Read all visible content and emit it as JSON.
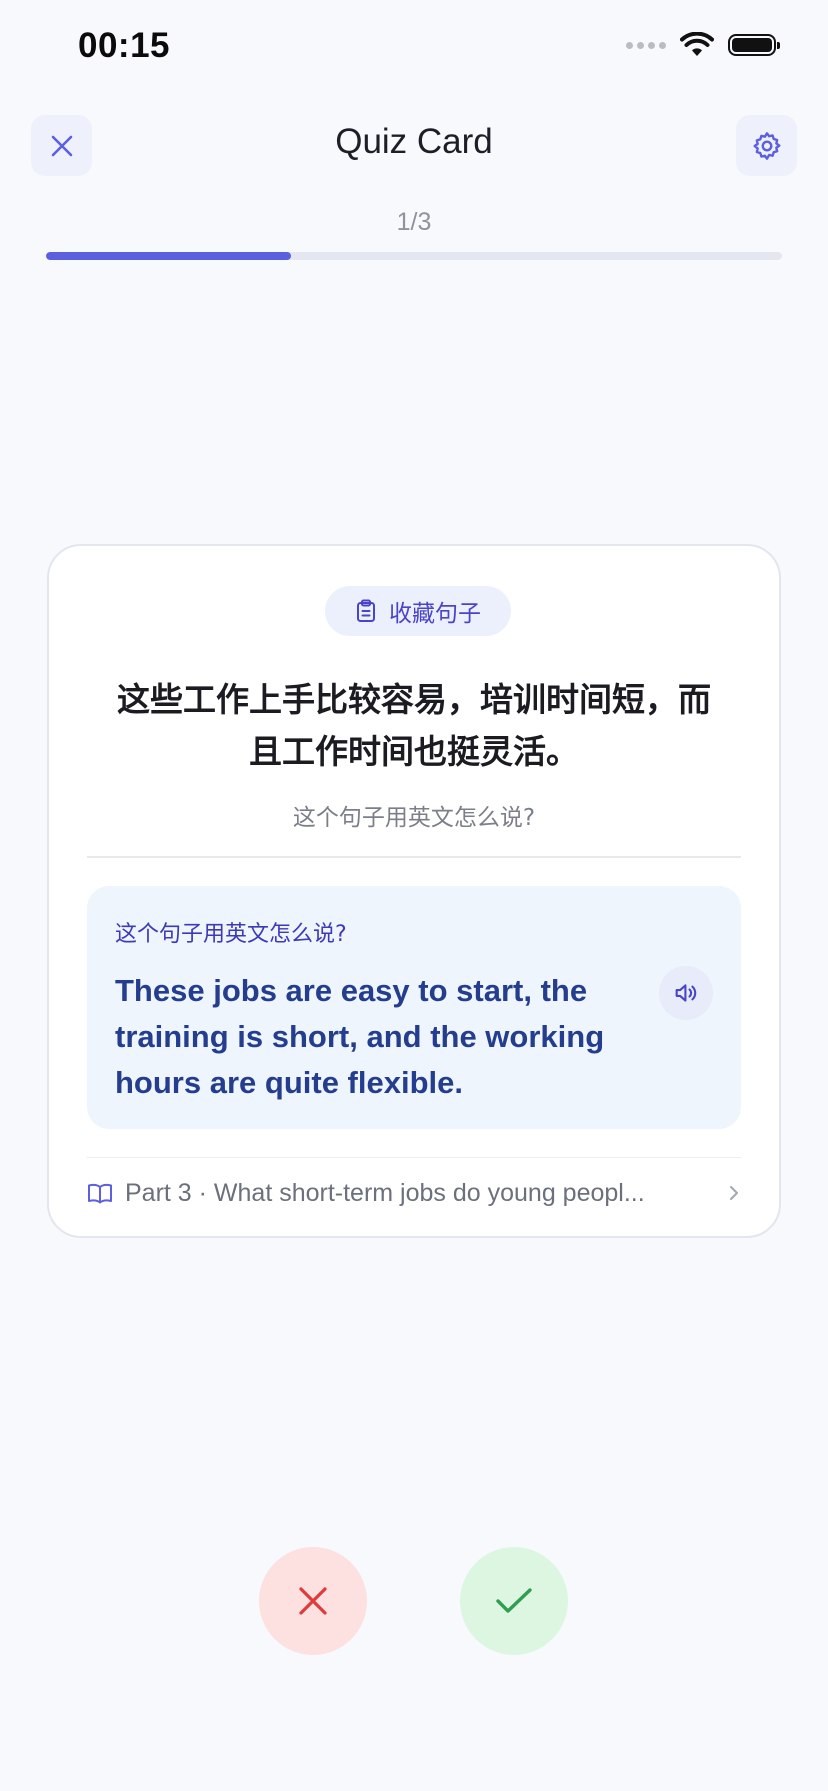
{
  "status_bar": {
    "time": "00:15"
  },
  "header": {
    "title": "Quiz Card",
    "close_icon": "close-icon",
    "settings_icon": "gear-icon"
  },
  "progress": {
    "label": "1/3",
    "fraction": 0.3333
  },
  "card": {
    "tag": {
      "icon": "clipboard-icon",
      "label": "收藏句子"
    },
    "sentence_line1": "这些工作上手比较容易，培训时间短，而",
    "sentence_line2": "且工作时间也挺灵活。",
    "prompt": "这个句子用英文怎么说?",
    "answer": {
      "label": "这个句子用英文怎么说?",
      "text": "These jobs are easy to start, the training is short, and the working hours are quite flexible.",
      "audio_icon": "speaker-icon"
    },
    "source": {
      "icon": "book-icon",
      "text": "Part 3 · What short-term jobs do young peopl..."
    }
  },
  "actions": {
    "wrong_icon": "x-icon",
    "right_icon": "check-icon"
  },
  "colors": {
    "accent": "#5b5fe0",
    "answer_text": "#243d8f",
    "wrong_bg": "#fde0e0",
    "wrong_icon": "#e03a3a",
    "right_bg": "#dcf6e2",
    "right_icon": "#2e9e4f"
  }
}
